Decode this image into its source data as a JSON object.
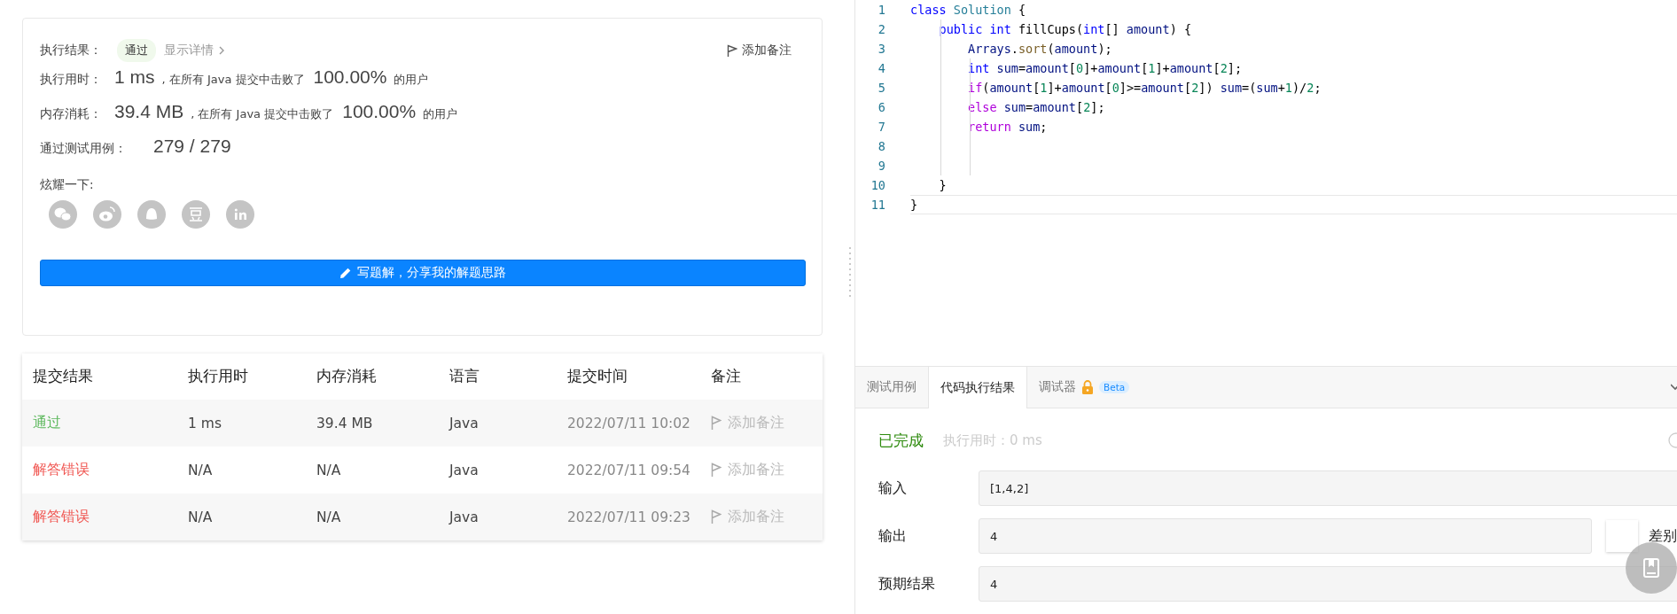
{
  "result_card": {
    "result_label": "执行结果：",
    "status": "通过",
    "details_link": "显示详情",
    "add_note": "添加备注",
    "runtime": {
      "label": "执行用时：",
      "value": "1 ms",
      "middle": ", 在所有 Java 提交中击败了",
      "percent": "100.00%",
      "suffix": "的用户"
    },
    "memory": {
      "label": "内存消耗：",
      "value": "39.4 MB",
      "middle": ", 在所有 Java 提交中击败了",
      "percent": "100.00%",
      "suffix": "的用户"
    },
    "tests": {
      "label": "通过测试用例：",
      "value": "279 / 279"
    },
    "share_label": "炫耀一下:",
    "share_icons": [
      {
        "kind": "wechat"
      },
      {
        "kind": "weibo"
      },
      {
        "kind": "qq"
      },
      {
        "kind": "douban"
      },
      {
        "kind": "linkedin"
      }
    ],
    "write_button": "写题解，分享我的解题思路"
  },
  "submissions": {
    "columns": [
      "提交结果",
      "执行用时",
      "内存消耗",
      "语言",
      "提交时间",
      "备注"
    ],
    "rows": [
      {
        "status": "通过",
        "kind": "accepted",
        "runtime": "1 ms",
        "memory": "39.4 MB",
        "language": "Java",
        "time": "2022/07/11 10:02",
        "note": "添加备注"
      },
      {
        "status": "解答错误",
        "kind": "wrong",
        "runtime": "N/A",
        "memory": "N/A",
        "language": "Java",
        "time": "2022/07/11 09:54",
        "note": "添加备注"
      },
      {
        "status": "解答错误",
        "kind": "wrong",
        "runtime": "N/A",
        "memory": "N/A",
        "language": "Java",
        "time": "2022/07/11 09:23",
        "note": "添加备注"
      }
    ]
  },
  "editor": {
    "lines": [
      {
        "number": "1",
        "tokens": [
          {
            "kind": "kw",
            "t": "class"
          },
          {
            "kind": "cls",
            "t": " Solution"
          },
          {
            "kind": "plain",
            "t": " {"
          }
        ]
      },
      {
        "number": "2",
        "tokens": [
          {
            "kind": "kw",
            "t": "    public"
          },
          {
            "kind": "kw",
            "t": " int"
          },
          {
            "kind": "plain",
            "t": " fillCups("
          },
          {
            "kind": "kw",
            "t": "int"
          },
          {
            "kind": "plain",
            "t": "[] "
          },
          {
            "kind": "var",
            "t": "amount"
          },
          {
            "kind": "plain",
            "t": ") {"
          }
        ]
      },
      {
        "number": "3",
        "tokens": [
          {
            "kind": "var",
            "t": "        Arrays"
          },
          {
            "kind": "plain",
            "t": "."
          },
          {
            "kind": "fn",
            "t": "sort"
          },
          {
            "kind": "plain",
            "t": "("
          },
          {
            "kind": "var",
            "t": "amount"
          },
          {
            "kind": "plain",
            "t": ");"
          }
        ]
      },
      {
        "number": "4",
        "tokens": [
          {
            "kind": "kw",
            "t": "        int"
          },
          {
            "kind": "var",
            "t": " sum"
          },
          {
            "kind": "plain",
            "t": "="
          },
          {
            "kind": "var",
            "t": "amount"
          },
          {
            "kind": "plain",
            "t": "["
          },
          {
            "kind": "num",
            "t": "0"
          },
          {
            "kind": "plain",
            "t": "]+"
          },
          {
            "kind": "var",
            "t": "amount"
          },
          {
            "kind": "plain",
            "t": "["
          },
          {
            "kind": "num",
            "t": "1"
          },
          {
            "kind": "plain",
            "t": "]+"
          },
          {
            "kind": "var",
            "t": "amount"
          },
          {
            "kind": "plain",
            "t": "["
          },
          {
            "kind": "num",
            "t": "2"
          },
          {
            "kind": "plain",
            "t": "];"
          }
        ]
      },
      {
        "number": "5",
        "tokens": [
          {
            "kind": "ctrl",
            "t": "        if"
          },
          {
            "kind": "plain",
            "t": "("
          },
          {
            "kind": "var",
            "t": "amount"
          },
          {
            "kind": "plain",
            "t": "["
          },
          {
            "kind": "num",
            "t": "1"
          },
          {
            "kind": "plain",
            "t": "]+"
          },
          {
            "kind": "var",
            "t": "amount"
          },
          {
            "kind": "plain",
            "t": "["
          },
          {
            "kind": "num",
            "t": "0"
          },
          {
            "kind": "plain",
            "t": "]>="
          },
          {
            "kind": "var",
            "t": "amount"
          },
          {
            "kind": "plain",
            "t": "["
          },
          {
            "kind": "num",
            "t": "2"
          },
          {
            "kind": "plain",
            "t": "]) "
          },
          {
            "kind": "var",
            "t": "sum"
          },
          {
            "kind": "plain",
            "t": "=("
          },
          {
            "kind": "var",
            "t": "sum"
          },
          {
            "kind": "plain",
            "t": "+"
          },
          {
            "kind": "num",
            "t": "1"
          },
          {
            "kind": "plain",
            "t": ")/"
          },
          {
            "kind": "num",
            "t": "2"
          },
          {
            "kind": "plain",
            "t": ";"
          }
        ]
      },
      {
        "number": "6",
        "tokens": [
          {
            "kind": "ctrl",
            "t": "        else"
          },
          {
            "kind": "var",
            "t": " sum"
          },
          {
            "kind": "plain",
            "t": "="
          },
          {
            "kind": "var",
            "t": "amount"
          },
          {
            "kind": "plain",
            "t": "["
          },
          {
            "kind": "num",
            "t": "2"
          },
          {
            "kind": "plain",
            "t": "];"
          }
        ]
      },
      {
        "number": "7",
        "tokens": [
          {
            "kind": "ctrl",
            "t": "        return"
          },
          {
            "kind": "var",
            "t": " sum"
          },
          {
            "kind": "plain",
            "t": ";"
          }
        ]
      },
      {
        "number": "8"
      },
      {
        "number": "9"
      },
      {
        "number": "10",
        "tokens": [
          {
            "kind": "plain",
            "t": "    }"
          }
        ]
      },
      {
        "number": "11",
        "tokens": [
          {
            "kind": "plain",
            "t": "}"
          }
        ],
        "current": true
      }
    ]
  },
  "console": {
    "tabs": [
      {
        "label": "测试用例",
        "selected": false
      },
      {
        "label": "代码执行结果",
        "selected": true
      },
      {
        "label": "调试器",
        "selected": false,
        "locked": true,
        "badge": "Beta"
      }
    ],
    "status": "已完成",
    "runtime": "执行用时：0 ms",
    "rows": [
      {
        "label": "输入",
        "value": "[1,4,2]"
      },
      {
        "label": "输出",
        "value": "4",
        "diff_label": "差别",
        "diff_on": false
      },
      {
        "label": "预期结果",
        "value": "4"
      }
    ]
  }
}
